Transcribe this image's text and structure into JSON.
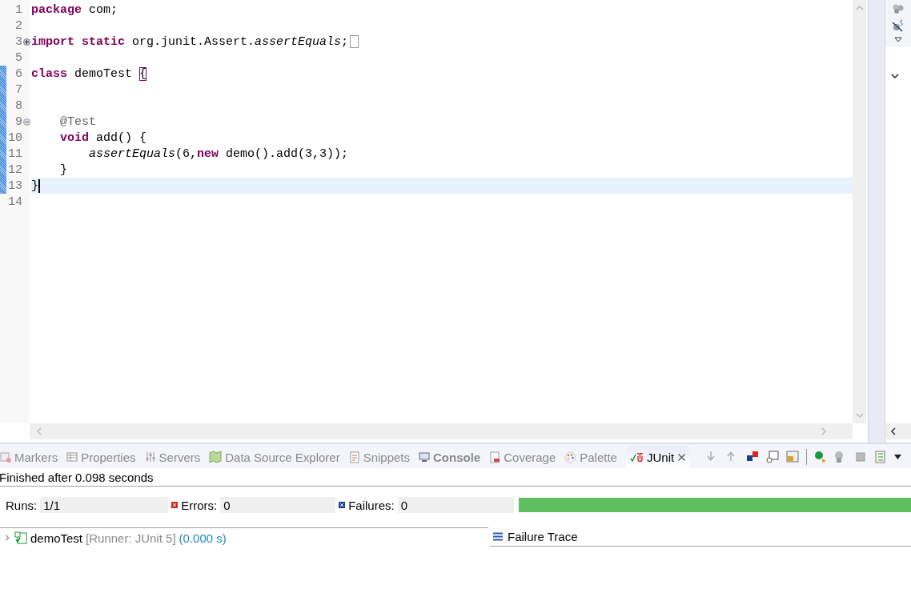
{
  "editor": {
    "lines": [
      {
        "number": "1",
        "changed": false,
        "current": false,
        "tokens": [
          {
            "kind": "keyword",
            "text": "package"
          },
          {
            "kind": "plain",
            "text": " com;"
          }
        ]
      },
      {
        "number": "2",
        "changed": false,
        "current": false
      },
      {
        "number": "3",
        "changed": false,
        "current": false,
        "collapsed": true,
        "tokens": [
          {
            "kind": "keyword",
            "text": "import static"
          },
          {
            "kind": "plain",
            "text": " org.junit.Assert."
          },
          {
            "kind": "italic",
            "text": "assertEquals"
          },
          {
            "kind": "plain",
            "text": ";"
          }
        ]
      },
      {
        "number": "5",
        "changed": false,
        "current": false
      },
      {
        "number": "6",
        "changed": true,
        "current": false,
        "tokens": [
          {
            "kind": "keyword",
            "text": "class"
          },
          {
            "kind": "plain",
            "text": " demoTest "
          },
          {
            "kind": "bracket",
            "text": "{"
          }
        ]
      },
      {
        "number": "7",
        "changed": true,
        "current": false
      },
      {
        "number": "8",
        "changed": true,
        "current": false
      },
      {
        "number": "9",
        "changed": true,
        "current": false,
        "collapsed": false,
        "tokens": [
          {
            "kind": "annotation",
            "text": "    @Test"
          }
        ]
      },
      {
        "number": "10",
        "changed": true,
        "current": false,
        "tokens": [
          {
            "kind": "keyword",
            "text": "    void"
          },
          {
            "kind": "plain",
            "text": " add() {"
          }
        ]
      },
      {
        "number": "11",
        "changed": true,
        "current": false,
        "tokens": [
          {
            "kind": "italic",
            "text": "        assertEquals"
          },
          {
            "kind": "plain",
            "text": "(6,"
          },
          {
            "kind": "keyword",
            "text": "new"
          },
          {
            "kind": "plain",
            "text": " demo().add(3,3));"
          }
        ]
      },
      {
        "number": "12",
        "changed": true,
        "current": false,
        "tokens": [
          {
            "kind": "plain",
            "text": "    }"
          }
        ]
      },
      {
        "number": "13",
        "changed": true,
        "current": true,
        "tokens": [
          {
            "kind": "plain",
            "text": "}"
          }
        ]
      },
      {
        "number": "14",
        "changed": false,
        "current": false
      }
    ]
  },
  "bottom_panel": {
    "tabs": [
      {
        "label": "Markers",
        "selected": false,
        "emphasized": false,
        "closable": false
      },
      {
        "label": "Properties",
        "selected": false,
        "emphasized": false,
        "closable": false
      },
      {
        "label": "Servers",
        "selected": false,
        "emphasized": false,
        "closable": false
      },
      {
        "label": "Data Source Explorer",
        "selected": false,
        "emphasized": false,
        "closable": false
      },
      {
        "label": "Snippets",
        "selected": false,
        "emphasized": false,
        "closable": false
      },
      {
        "label": "Console",
        "selected": false,
        "emphasized": true,
        "closable": false
      },
      {
        "label": "Coverage",
        "selected": false,
        "emphasized": false,
        "closable": false
      },
      {
        "label": "Palette",
        "selected": false,
        "emphasized": false,
        "closable": false
      },
      {
        "label": "JUnit",
        "selected": true,
        "emphasized": false,
        "closable": true
      }
    ],
    "junit": {
      "status": "Finished after 0.098 seconds",
      "counters": [
        {
          "kind": "runs",
          "label": "Runs:",
          "value": "1/1"
        },
        {
          "kind": "errors",
          "label": "Errors:",
          "value": "0"
        },
        {
          "kind": "failures",
          "label": "Failures:",
          "value": "0"
        }
      ],
      "progress": {
        "level": 1,
        "failed": false
      },
      "tree": [
        {
          "name": "demoTest",
          "runner": "[Runner: JUnit 5]",
          "time": "(0.000 s)",
          "expanded": false
        }
      ],
      "failure_trace": {
        "title": "Failure Trace"
      }
    }
  }
}
